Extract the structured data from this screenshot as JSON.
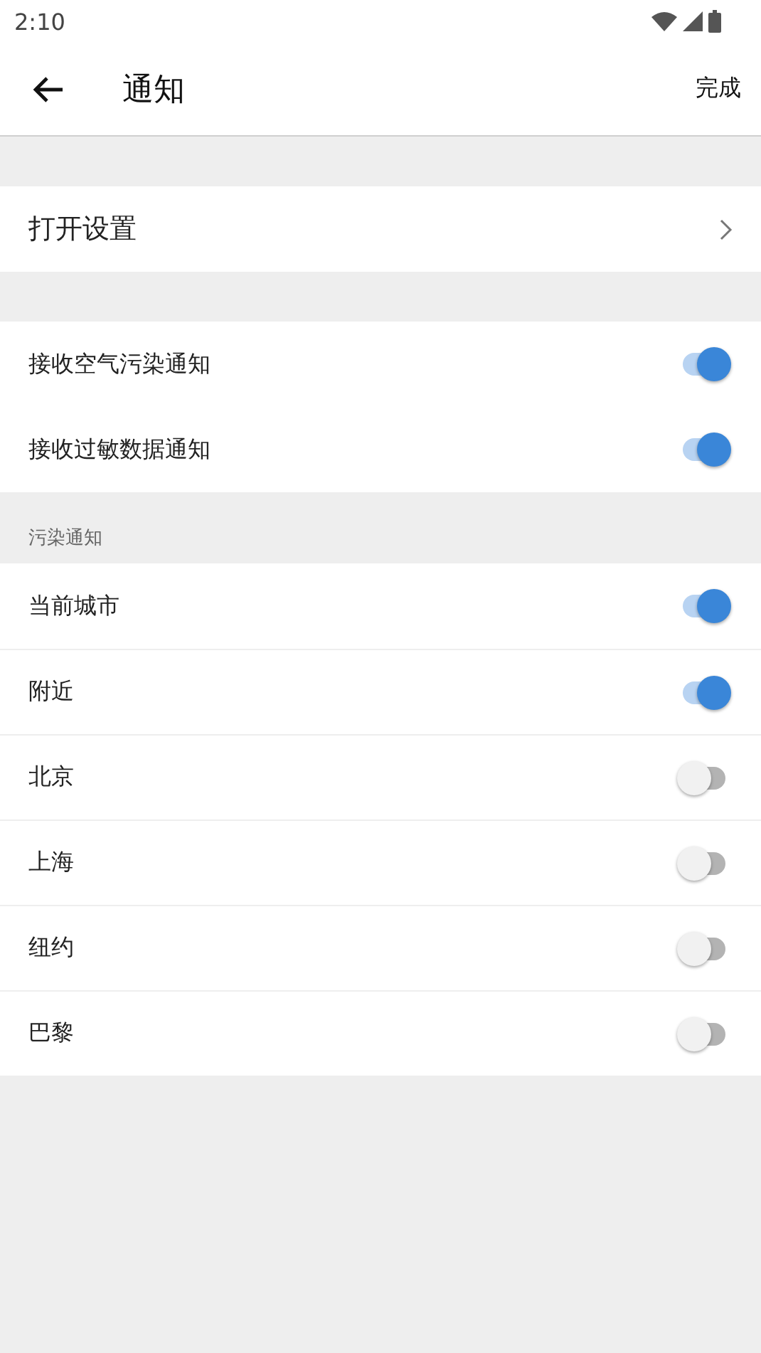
{
  "status_bar": {
    "time": "2:10"
  },
  "header": {
    "title": "通知",
    "action": "完成"
  },
  "settings_link": {
    "label": "打开设置"
  },
  "general": [
    {
      "label": "接收空气污染通知",
      "on": true
    },
    {
      "label": "接收过敏数据通知",
      "on": true
    }
  ],
  "pollution": {
    "heading": "污染通知",
    "items": [
      {
        "label": "当前城市",
        "on": true
      },
      {
        "label": "附近",
        "on": true
      },
      {
        "label": "北京",
        "on": false
      },
      {
        "label": "上海",
        "on": false
      },
      {
        "label": "纽约",
        "on": false
      },
      {
        "label": "巴黎",
        "on": false
      }
    ]
  }
}
